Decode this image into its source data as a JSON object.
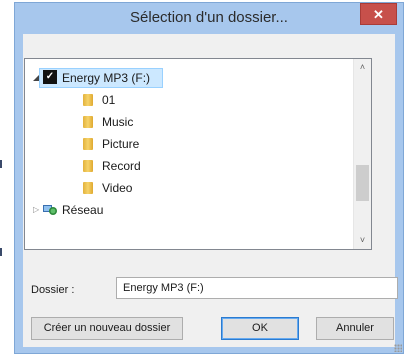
{
  "window": {
    "title": "Sélection d'un dossier...",
    "close_glyph": "✕"
  },
  "tree": {
    "drive_label": "Energy MP3 (F:)",
    "folders": [
      "01",
      "Music",
      "Picture",
      "Record",
      "Video"
    ],
    "network_label": "Réseau",
    "scroll_up": "˄",
    "scroll_down": "˅"
  },
  "folder_field": {
    "label": "Dossier :",
    "value": "Energy MP3 (F:)"
  },
  "buttons": {
    "new_folder": "Créer un nouveau dossier",
    "ok": "OK",
    "cancel": "Annuler"
  },
  "icons": {
    "drive": "checkmark-drive-icon",
    "folder": "folder-icon",
    "network": "network-globe-icon"
  },
  "colors": {
    "title_bar": "#a7c7ed",
    "close_button": "#c7504b",
    "selection": "#cce8ff",
    "folder": "#e8b33a"
  }
}
